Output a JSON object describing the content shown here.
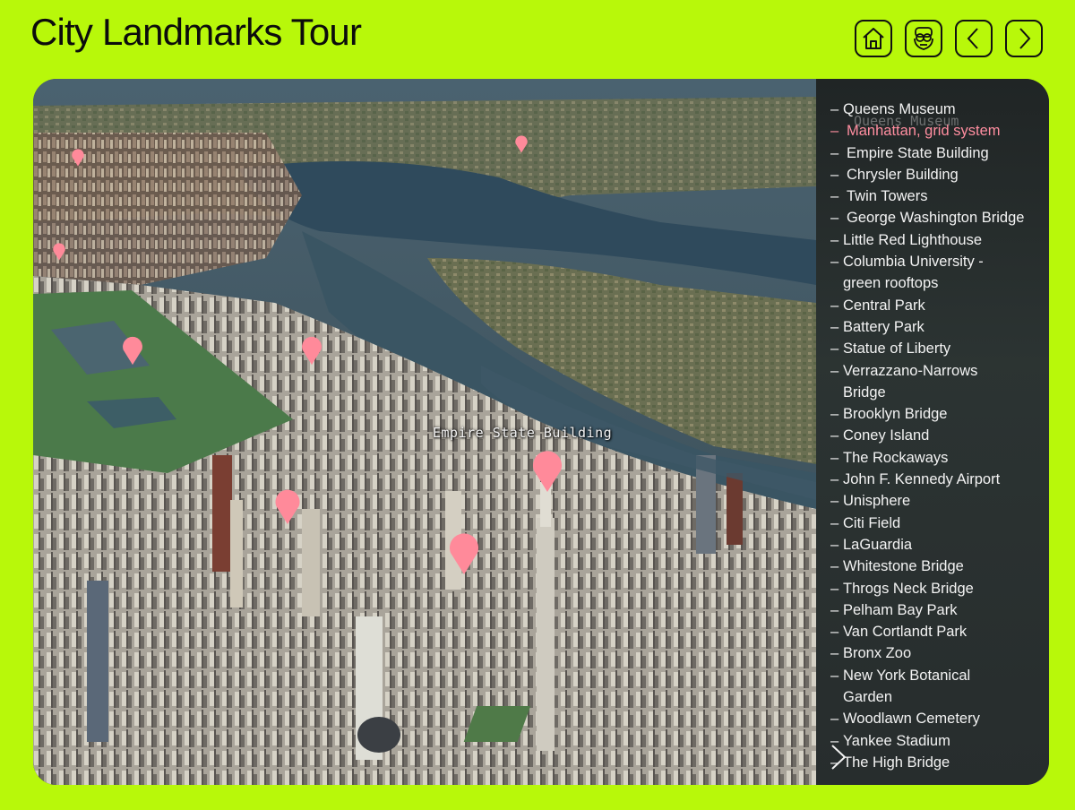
{
  "app": {
    "title": "City Landmarks Tour"
  },
  "nav": {
    "buttons": [
      "home-icon",
      "viewer-icon",
      "chevron-left-icon",
      "chevron-right-icon"
    ]
  },
  "map": {
    "label": "Empire State Building",
    "ghost_label": "Queens Museum",
    "pin_color": "#ff8a9a"
  },
  "landmarks": {
    "active_index": 1,
    "items": [
      "Queens Museum",
      "Manhattan, grid system",
      "Empire State Building",
      "Chrysler Building",
      "Twin Towers",
      "George Washington Bridge",
      "Little Red Lighthouse",
      "Columbia University - green rooftops",
      "Central Park",
      "Battery Park",
      "Statue of Liberty",
      "Verrazzano-Narrows Bridge",
      "Brooklyn Bridge",
      "Coney Island",
      "The Rockaways",
      "John F. Kennedy Airport",
      "Unisphere",
      "Citi Field",
      "LaGuardia",
      "Whitestone Bridge",
      "Throgs Neck Bridge",
      "Pelham Bay Park",
      "Van Cortlandt Park",
      "Bronx Zoo",
      "New York Botanical Garden",
      "Woodlawn Cemetery",
      "Yankee Stadium",
      "The High Bridge"
    ]
  },
  "colors": {
    "accent": "#b8f80a",
    "active_item": "#ff8ea0",
    "panel": "#262b2a"
  }
}
